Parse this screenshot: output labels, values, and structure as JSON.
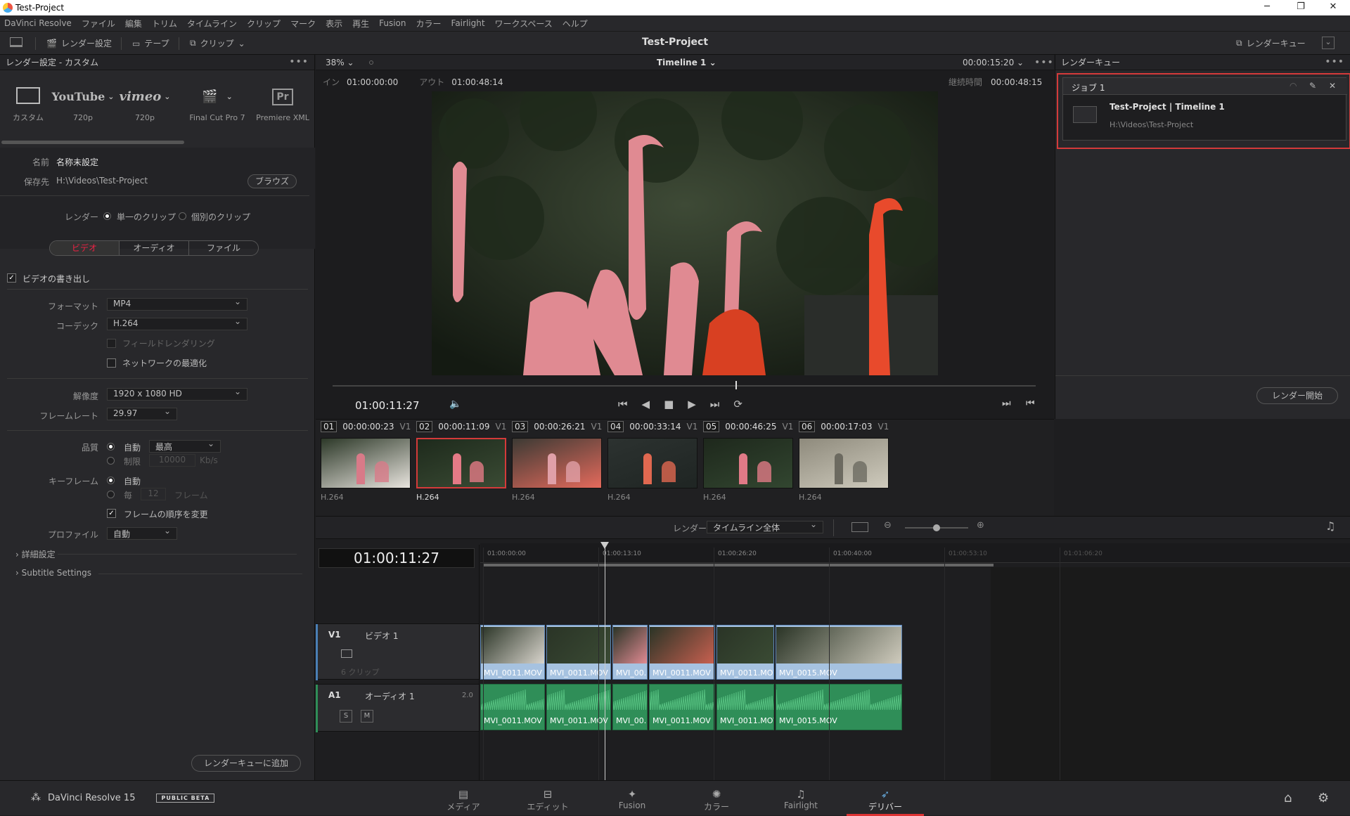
{
  "window": {
    "title": "Test-Project",
    "minimize": "─",
    "maximize": "❐",
    "close": "✕"
  },
  "menu": [
    "DaVinci Resolve",
    "ファイル",
    "編集",
    "トリム",
    "タイムライン",
    "クリップ",
    "マーク",
    "表示",
    "再生",
    "Fusion",
    "カラー",
    "Fairlight",
    "ワークスペース",
    "ヘルプ"
  ],
  "toolbar": {
    "render_settings": "レンダー設定",
    "tape": "テープ",
    "clips": "クリップ",
    "project_title": "Test-Project",
    "render_queue": "レンダーキュー"
  },
  "render_settings": {
    "header": "レンダー設定 - カスタム",
    "presets": [
      {
        "label": "カスタム",
        "icon": "film-icon"
      },
      {
        "label": "720p",
        "icon": "youtube-icon",
        "logo": "YouTube"
      },
      {
        "label": "720p",
        "icon": "vimeo-icon",
        "logo": "vimeo"
      },
      {
        "label": "Final Cut Pro 7",
        "icon": "clapper-icon"
      },
      {
        "label": "Premiere XML",
        "icon": "premiere-icon",
        "logo": "Pr"
      }
    ],
    "name_label": "名前",
    "name_value": "名称未設定",
    "location_label": "保存先",
    "location_value": "H:\\Videos\\Test-Project",
    "browse": "ブラウズ",
    "render_label": "レンダー",
    "single_clip": "単一のクリップ",
    "individual_clips": "個別のクリップ",
    "tabs": [
      "ビデオ",
      "オーディオ",
      "ファイル"
    ],
    "export_video": "ビデオの書き出し",
    "format_label": "フォーマット",
    "format_value": "MP4",
    "codec_label": "コーデック",
    "codec_value": "H.264",
    "field_rendering": "フィールドレンダリング",
    "network_optimize": "ネットワークの最適化",
    "resolution_label": "解像度",
    "resolution_value": "1920 x 1080 HD",
    "framerate_label": "フレームレート",
    "framerate_value": "29.97",
    "quality_label": "品質",
    "quality_auto": "自動",
    "quality_value": "最高",
    "quality_limit": "制限",
    "limit_value": "10000",
    "limit_unit": "Kb/s",
    "keyframe_label": "キーフレーム",
    "keyframe_auto": "自動",
    "keyframe_every": "毎",
    "keyframe_value": "12",
    "keyframe_unit": "フレーム",
    "frame_reorder": "フレームの順序を変更",
    "profile_label": "プロファイル",
    "profile_value": "自動",
    "advanced": "詳細設定",
    "subtitle": "Subtitle Settings",
    "add_to_queue": "レンダーキューに追加"
  },
  "viewer": {
    "zoom": "38%",
    "timeline_name": "Timeline 1",
    "timecode_top": "00:00:15:20",
    "in_label": "イン",
    "in_value": "01:00:00:00",
    "out_label": "アウト",
    "out_value": "01:00:48:14",
    "duration_label": "継続時間",
    "duration_value": "00:00:48:15",
    "current_tc": "01:00:11:27",
    "playhead_fraction": 0.573
  },
  "clips": [
    {
      "num": "01",
      "tc": "00:00:00:23",
      "track": "V1",
      "codec": "H.264"
    },
    {
      "num": "02",
      "tc": "00:00:11:09",
      "track": "V1",
      "codec": "H.264",
      "selected": true
    },
    {
      "num": "03",
      "tc": "00:00:26:21",
      "track": "V1",
      "codec": "H.264"
    },
    {
      "num": "04",
      "tc": "00:00:33:14",
      "track": "V1",
      "codec": "H.264"
    },
    {
      "num": "05",
      "tc": "00:00:46:25",
      "track": "V1",
      "codec": "H.264"
    },
    {
      "num": "06",
      "tc": "00:00:17:03",
      "track": "V1",
      "codec": "H.264"
    }
  ],
  "render_queue": {
    "header": "レンダーキュー",
    "job_label": "ジョブ 1",
    "job_title": "Test-Project | Timeline 1",
    "job_path": "H:\\Videos\\Test-Project",
    "start_render": "レンダー開始"
  },
  "timeline": {
    "render_label": "レンダー",
    "render_scope": "タイムライン全体",
    "timecode": "01:00:11:27",
    "ruler": [
      "01:00:00:00",
      "01:00:13:10",
      "01:00:26:20",
      "01:00:40:00",
      "01:00:53:10",
      "01:01:06:20"
    ],
    "v1": {
      "id": "V1",
      "name": "ビデオ 1",
      "clip_count": "6 クリップ"
    },
    "a1": {
      "id": "A1",
      "name": "オーディオ 1",
      "channels": "2.0",
      "solo": "S",
      "mute": "M"
    },
    "video_clips": [
      "MVI_0011.MOV",
      "MVI_0011.MOV",
      "MVI_00...",
      "MVI_0011.MOV",
      "MVI_0011.MOV",
      "MVI_0015.MOV"
    ],
    "audio_clips": [
      "MVI_0011.MOV",
      "MVI_0011.MOV",
      "MVI_00...",
      "MVI_0011.MOV",
      "MVI_0011.MOV",
      "MVI_0015.MOV"
    ]
  },
  "bottom": {
    "app": "DaVinci Resolve 15",
    "beta": "PUBLIC BETA",
    "pages": [
      "メディア",
      "エディット",
      "Fusion",
      "カラー",
      "Fairlight",
      "デリバー"
    ],
    "active_page": "デリバー"
  },
  "colors": {
    "accent_red": "#d43a3a",
    "video_clip": "#a6c2e0",
    "audio_clip": "#2f8e58"
  }
}
